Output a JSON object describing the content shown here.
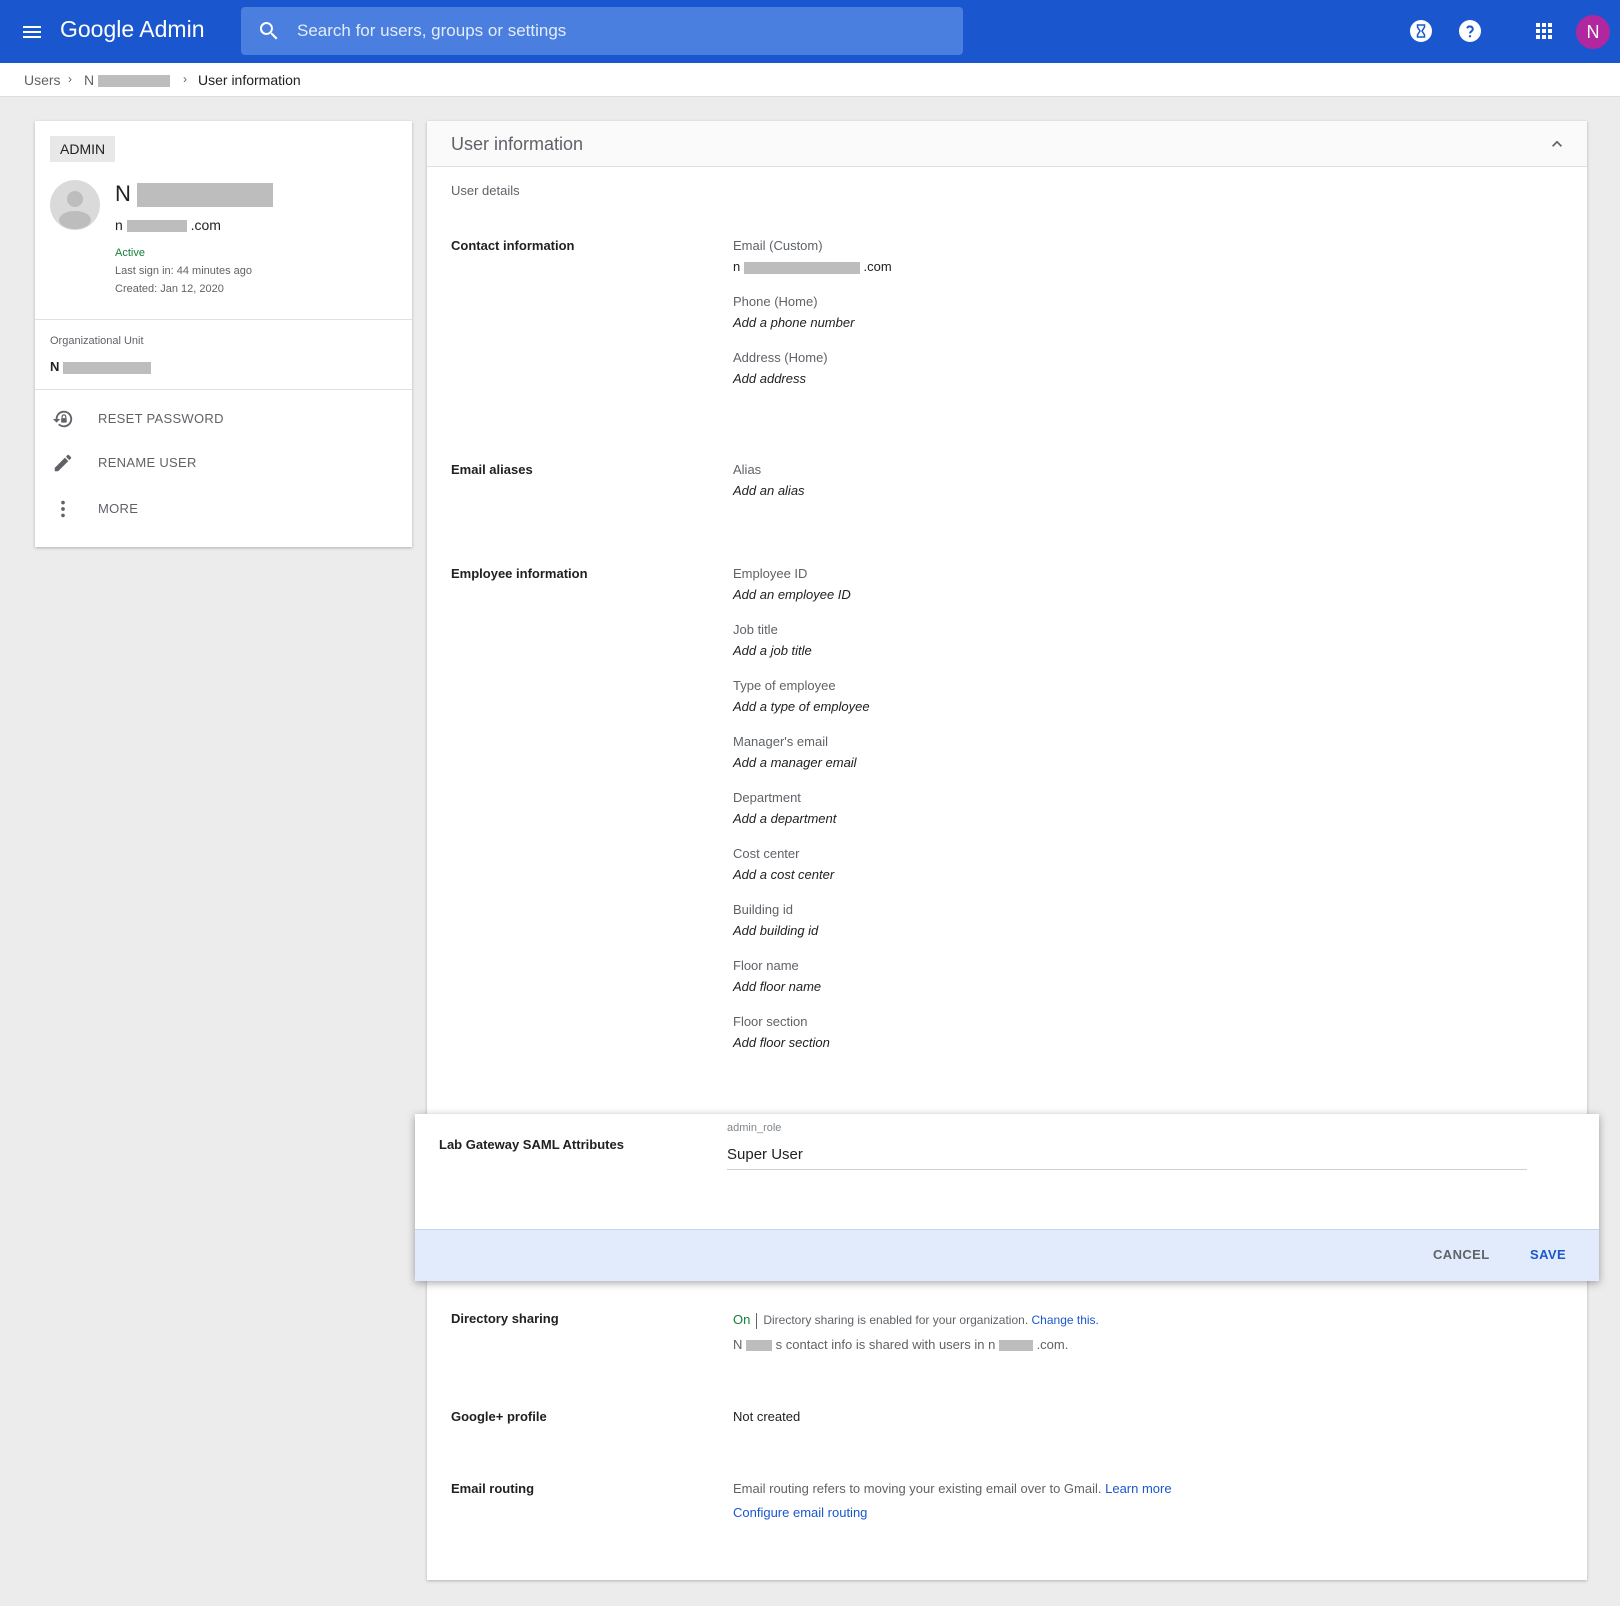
{
  "topbar": {
    "brand_google": "Google",
    "brand_admin": "Admin",
    "search_placeholder": "Search for users, groups or settings",
    "avatar_letter": "N"
  },
  "breadcrumb": {
    "users": "Users",
    "user_initial": "N",
    "current": "User information"
  },
  "profile": {
    "badge": "ADMIN",
    "name_initial": "N",
    "email_prefix": "n",
    "email_suffix": ".com",
    "status": "Active",
    "last_sign_in": "Last sign in: 44 minutes ago",
    "created": "Created: Jan 12, 2020",
    "ou_label": "Organizational Unit",
    "ou_initial": "N",
    "actions": [
      {
        "label": "RESET PASSWORD",
        "icon": "lock-reset-icon"
      },
      {
        "label": "RENAME USER",
        "icon": "pencil-icon"
      },
      {
        "label": "MORE",
        "icon": "more-vert-icon"
      }
    ]
  },
  "main": {
    "title": "User information",
    "subhead": "User details",
    "contact": {
      "label": "Contact information",
      "email_label": "Email (Custom)",
      "email_prefix": "n",
      "email_suffix": ".com",
      "phone_label": "Phone (Home)",
      "phone_value": "Add a phone number",
      "address_label": "Address (Home)",
      "address_value": "Add address"
    },
    "aliases": {
      "label": "Email aliases",
      "alias_label": "Alias",
      "alias_value": "Add an alias"
    },
    "employee": {
      "label": "Employee information",
      "fields": [
        {
          "label": "Employee ID",
          "value": "Add an employee ID"
        },
        {
          "label": "Job title",
          "value": "Add a job title"
        },
        {
          "label": "Type of employee",
          "value": "Add a type of employee"
        },
        {
          "label": "Manager's email",
          "value": "Add a manager email"
        },
        {
          "label": "Department",
          "value": "Add a department"
        },
        {
          "label": "Cost center",
          "value": "Add a cost center"
        },
        {
          "label": "Building id",
          "value": "Add building id"
        },
        {
          "label": "Floor name",
          "value": "Add floor name"
        },
        {
          "label": "Floor section",
          "value": "Add floor section"
        }
      ]
    },
    "saml": {
      "label": "Lab Gateway SAML Attributes",
      "field_label": "admin_role",
      "field_value": "Super User",
      "cancel": "CANCEL",
      "save": "SAVE"
    },
    "directory": {
      "label": "Directory sharing",
      "status": "On",
      "description": "Directory sharing is enabled for your organization.",
      "change_link": "Change this.",
      "shared_prefix": "N",
      "shared_middle": "s contact info is shared with users in n",
      "shared_suffix": ".com."
    },
    "gplus": {
      "label": "Google+ profile",
      "value": "Not created"
    },
    "routing": {
      "label": "Email routing",
      "description": "Email routing refers to moving your existing email over to Gmail.",
      "learn_more": "Learn more",
      "configure": "Configure email routing"
    }
  }
}
